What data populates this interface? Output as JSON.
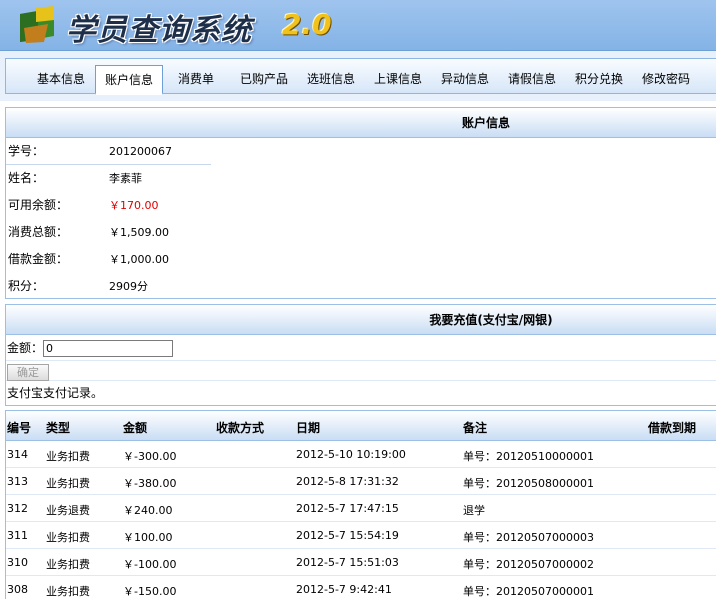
{
  "header": {
    "title": "学员查询系统",
    "version": "2.0"
  },
  "nav": {
    "tabs": [
      {
        "label": "基本信息"
      },
      {
        "label": "账户信息",
        "active": true
      },
      {
        "label": "消费单"
      },
      {
        "label": "已购产品"
      },
      {
        "label": "选班信息"
      },
      {
        "label": "上课信息"
      },
      {
        "label": "异动信息"
      },
      {
        "label": "请假信息"
      },
      {
        "label": "积分兑换"
      },
      {
        "label": "修改密码"
      }
    ]
  },
  "account": {
    "title": "账户信息",
    "fields": [
      {
        "label": "学号：",
        "value": "201200067"
      },
      {
        "label": "姓名：",
        "value": "李素菲"
      },
      {
        "label": "可用余额：",
        "value": "￥170.00",
        "color": "#e00000"
      },
      {
        "label": "消费总额：",
        "value": "￥1,509.00"
      },
      {
        "label": "借款金额：",
        "value": "￥1,000.00"
      },
      {
        "label": "积分：",
        "value": "2909分"
      }
    ]
  },
  "recharge": {
    "title": "我要充值(支付宝/网银)",
    "amount_label": "金额：",
    "amount_value": "0",
    "confirm_label": "确定",
    "alipay_records_label": "支付宝支付记录。"
  },
  "records": {
    "headers": {
      "id": "编号",
      "type": "类型",
      "amount": "金额",
      "method": "收款方式",
      "date": "日期",
      "note": "备注",
      "due": "借款到期"
    },
    "rows": [
      {
        "id": "314",
        "type": "业务扣费",
        "amount": "￥-300.00",
        "method": "",
        "date": "2012-5-10 10:19:00",
        "note": "单号：20120510000001",
        "due": ""
      },
      {
        "id": "313",
        "type": "业务扣费",
        "amount": "￥-380.00",
        "method": "",
        "date": "2012-5-8 17:31:32",
        "note": "单号：20120508000001",
        "due": ""
      },
      {
        "id": "312",
        "type": "业务退费",
        "amount": "￥240.00",
        "method": "",
        "date": "2012-5-7 17:47:15",
        "note": "退学",
        "due": ""
      },
      {
        "id": "311",
        "type": "业务扣费",
        "amount": "￥100.00",
        "method": "",
        "date": "2012-5-7 15:54:19",
        "note": "单号：20120507000003",
        "due": ""
      },
      {
        "id": "310",
        "type": "业务扣费",
        "amount": "￥-100.00",
        "method": "",
        "date": "2012-5-7 15:51:03",
        "note": "单号：20120507000002",
        "due": ""
      },
      {
        "id": "308",
        "type": "业务扣费",
        "amount": "￥-150.00",
        "method": "",
        "date": "2012-5-7 9:42:41",
        "note": "单号：20120507000001",
        "due": ""
      }
    ]
  }
}
